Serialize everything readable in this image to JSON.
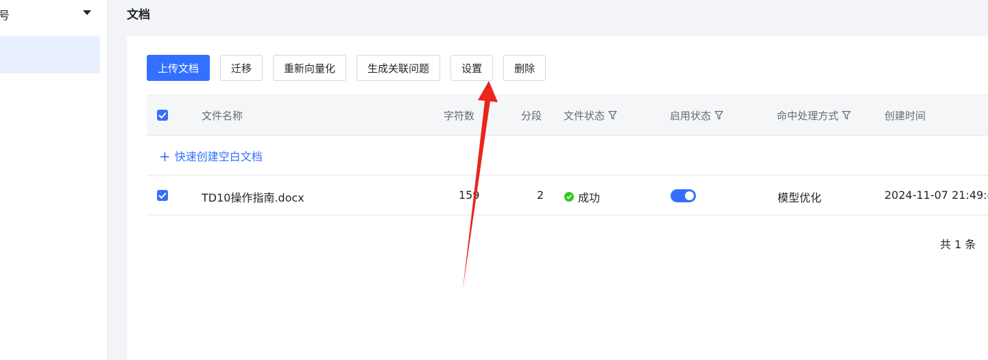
{
  "sidebar": {
    "top_label": "号"
  },
  "header": {
    "title": "文档"
  },
  "toolbar": {
    "upload": "上传文档",
    "migrate": "迁移",
    "revectorize": "重新向量化",
    "generate_questions": "生成关联问题",
    "settings": "设置",
    "delete": "删除"
  },
  "table": {
    "columns": {
      "name": "文件名称",
      "chars": "字符数",
      "segments": "分段",
      "file_status": "文件状态",
      "enable_status": "启用状态",
      "hit_handling": "命中处理方式",
      "created": "创建时间"
    },
    "quick_create": "快速创建空白文档",
    "rows": [
      {
        "name": "TD10操作指南.docx",
        "chars": "159",
        "segments": "2",
        "file_status": "成功",
        "enabled": true,
        "hit_handling": "模型优化",
        "created": "2024-11-07 21:49:4"
      }
    ],
    "total": "共 1 条"
  },
  "colors": {
    "primary": "#3370ff",
    "success": "#34c724",
    "annotation_arrow": "#e8261c"
  },
  "icons": [
    "chevron-down-icon",
    "filter-icon",
    "checkbox-checked-icon",
    "plus-icon",
    "check-circle-icon",
    "annotation-arrow"
  ]
}
